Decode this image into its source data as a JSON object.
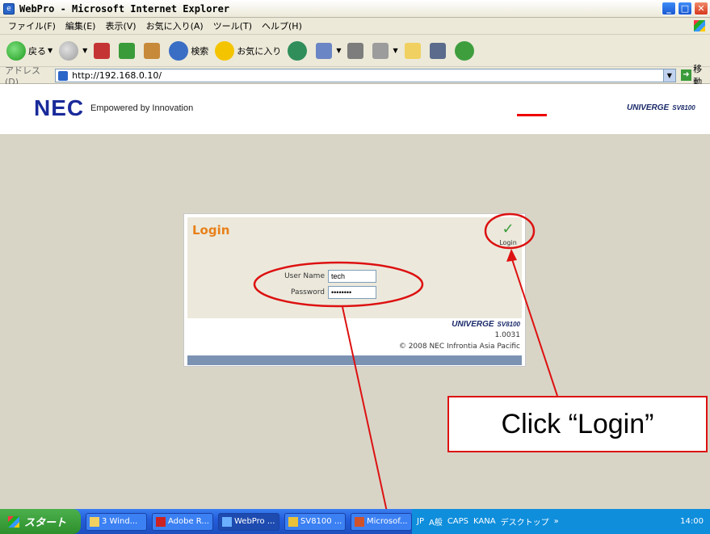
{
  "window": {
    "title": "WebPro - Microsoft Internet Explorer",
    "min_glyph": "_",
    "max_glyph": "□",
    "close_glyph": "✕"
  },
  "menubar": {
    "items": [
      "ファイル(F)",
      "編集(E)",
      "表示(V)",
      "お気に入り(A)",
      "ツール(T)",
      "ヘルプ(H)"
    ]
  },
  "toolbar": {
    "back_label": "戻る",
    "search_label": "検索",
    "favorites_label": "お気に入り",
    "icons": [
      "back-icon",
      "forward-icon",
      "stop-icon",
      "refresh-icon",
      "home-icon",
      "search-icon",
      "favorites-icon",
      "history-icon",
      "mail-icon",
      "print-icon",
      "edit-icon",
      "folder-icon",
      "research-icon",
      "messenger-icon"
    ]
  },
  "addressbar": {
    "label": "アドレス(D)",
    "url": "http://192.168.0.10/",
    "go_label": "移動"
  },
  "page": {
    "logo": "NEC",
    "tagline": "Empowered by Innovation",
    "brand": "UNIVERGE",
    "model": "SV8100",
    "login": {
      "title": "Login",
      "action_label": "Login",
      "username_label": "User Name",
      "username_value": "tech",
      "password_label": "Password",
      "password_value": "••••••••",
      "brand": "UNIVERGE",
      "model": "SV8100",
      "version": "1.0031",
      "copyright": "© 2008 NEC Infrontia Asia Pacific"
    }
  },
  "annotation": {
    "callout_text": "Click “Login”",
    "color": "#dd1111"
  },
  "taskbar": {
    "start_label": "スタート",
    "tasks": [
      "3 Wind...",
      "Adobe R...",
      "WebPro ...",
      "SV8100 ...",
      "Microsof..."
    ],
    "tray": {
      "lang": "JP",
      "mode": "A般",
      "caps": "CAPS",
      "kana": "KANA",
      "desktop": "デスクトップ",
      "chevron": "»",
      "time": "14:00"
    }
  }
}
